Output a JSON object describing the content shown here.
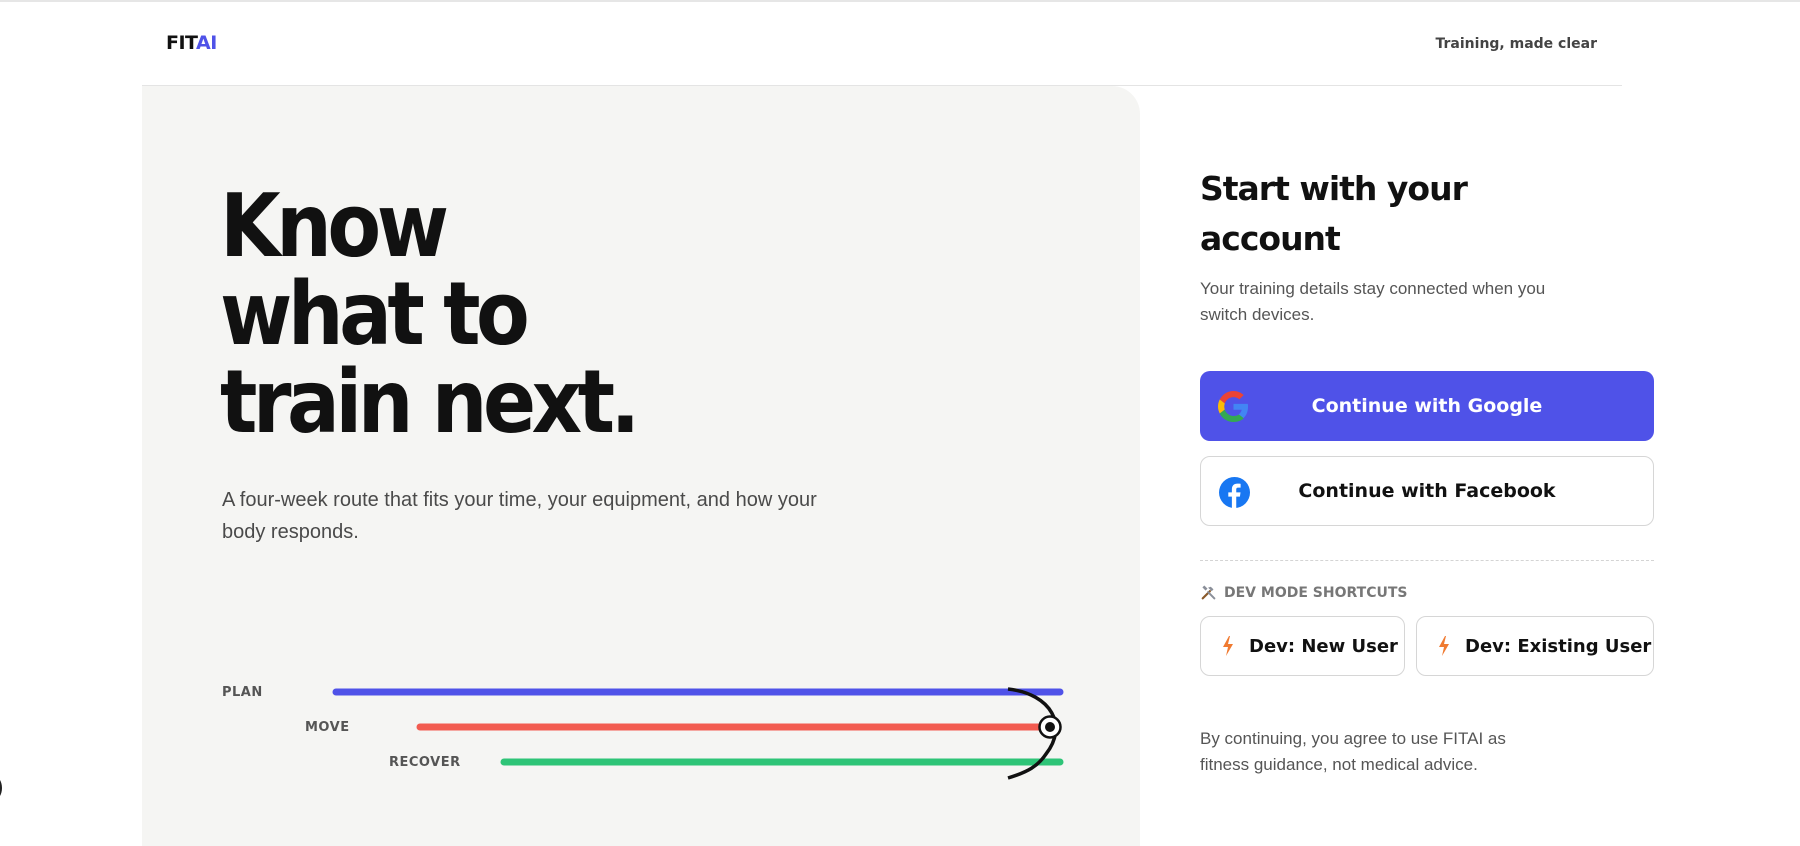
{
  "header": {
    "logo_part1": "FIT",
    "logo_part2": "AI",
    "tagline": "Training, made clear"
  },
  "hero": {
    "headline_line1": "Know",
    "headline_line2": "what to",
    "headline_line3": "train next.",
    "subtext": "A four-week route that fits your time, your equipment, and how your body responds."
  },
  "route_viz": {
    "lanes": [
      {
        "label": "PLAN",
        "color": "#4f52e8"
      },
      {
        "label": "MOVE",
        "color": "#f25b50"
      },
      {
        "label": "RECOVER",
        "color": "#2ec477"
      }
    ]
  },
  "signin": {
    "title_line1": "Start with your",
    "title_line2": "account",
    "subtitle": "Your training details stay connected when you switch devices.",
    "google_label": "Continue with Google",
    "facebook_label": "Continue with Facebook",
    "dev_section_label": "DEV MODE SHORTCUTS",
    "dev_new_label": "Dev: New User",
    "dev_existing_label": "Dev: Existing User",
    "legal": "By continuing, you agree to use FITAI as fitness guidance, not medical advice."
  },
  "colors": {
    "accent": "#4f52e8",
    "panel_bg": "#f5f5f3",
    "facebook_blue": "#1877f2",
    "bolt_orange": "#f07a30"
  }
}
